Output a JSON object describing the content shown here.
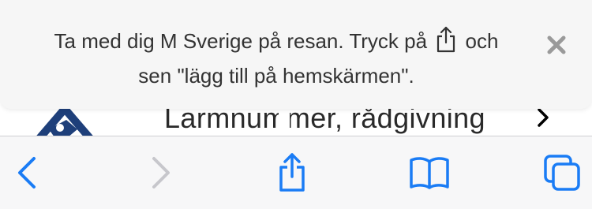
{
  "banner": {
    "message_part1": "Ta med dig M Sverige på resan. Tryck på",
    "message_part2": "och",
    "message_line2": "sen \"lägg till på hemskärmen\".",
    "share_icon": "share-icon",
    "close_icon": "close-icon"
  },
  "page": {
    "row_label": "Larmnummer, rådgivning",
    "row_icon": "chevron-right-icon"
  },
  "toolbar": {
    "back_icon": "chevron-left-icon",
    "forward_icon": "chevron-right-icon",
    "share_icon": "share-icon",
    "bookmarks_icon": "book-icon",
    "tabs_icon": "tabs-icon"
  },
  "colors": {
    "accent": "#1a7cf5",
    "disabled": "#c7c7cc",
    "logo_blue": "#1e3f7a",
    "banner_bg": "#f6f6f6",
    "toolbar_bg": "#f7f7f8",
    "close_gray": "#9a9a9a"
  }
}
